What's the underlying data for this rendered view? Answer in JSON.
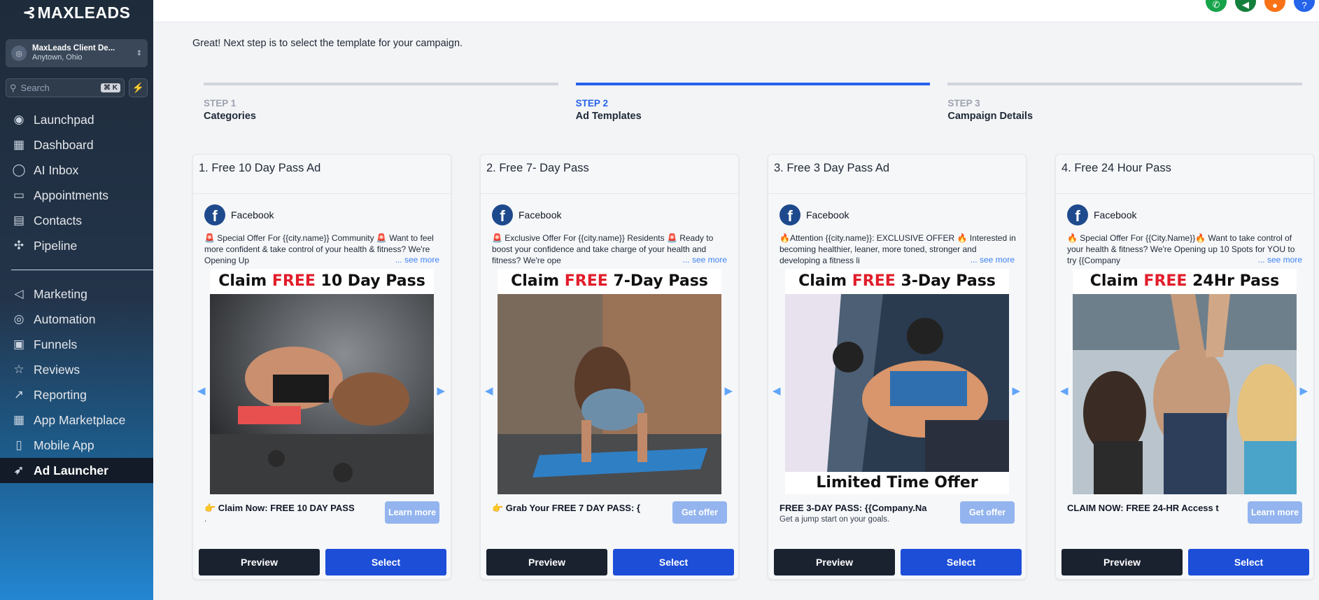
{
  "sidebar": {
    "logo": "MAXLEADS",
    "location": {
      "name": "MaxLeads Client De...",
      "city": "Anytown, Ohio"
    },
    "search": {
      "placeholder": "Search",
      "shortcut": "⌘ K"
    },
    "items": [
      {
        "label": "Launchpad",
        "icon": "rocket-circle-icon",
        "glyph": "◉"
      },
      {
        "label": "Dashboard",
        "icon": "grid-icon",
        "glyph": "▦"
      },
      {
        "label": "AI Inbox",
        "icon": "chat-icon",
        "glyph": "◯"
      },
      {
        "label": "Appointments",
        "icon": "calendar-icon",
        "glyph": "▭"
      },
      {
        "label": "Contacts",
        "icon": "contacts-icon",
        "glyph": "▤"
      },
      {
        "label": "Pipeline",
        "icon": "pipeline-icon",
        "glyph": "✣"
      }
    ],
    "items2": [
      {
        "label": "Marketing",
        "icon": "megaphone-icon",
        "glyph": "◁"
      },
      {
        "label": "Automation",
        "icon": "automation-icon",
        "glyph": "◎"
      },
      {
        "label": "Funnels",
        "icon": "funnel-icon",
        "glyph": "▣"
      },
      {
        "label": "Reviews",
        "icon": "star-icon",
        "glyph": "☆"
      },
      {
        "label": "Reporting",
        "icon": "trend-icon",
        "glyph": "↗"
      },
      {
        "label": "App Marketplace",
        "icon": "apps-icon",
        "glyph": "▦"
      },
      {
        "label": "Mobile App",
        "icon": "mobile-icon",
        "glyph": "▯"
      },
      {
        "label": "Ad Launcher",
        "icon": "rocket-icon",
        "glyph": "🚀"
      }
    ]
  },
  "topbar": {
    "icons": [
      {
        "name": "phone-icon",
        "glyph": "✆",
        "color": "#16a34a"
      },
      {
        "name": "megaphone-icon",
        "glyph": "◀",
        "color": "#15803d"
      },
      {
        "name": "bell-icon",
        "glyph": "●",
        "color": "#f97316"
      },
      {
        "name": "help-icon",
        "glyph": "?",
        "color": "#2563eb"
      }
    ]
  },
  "intro": "Great! Next step is to select the template for your campaign.",
  "steps": [
    {
      "num": "STEP 1",
      "label": "Categories"
    },
    {
      "num": "STEP 2",
      "label": "Ad Templates"
    },
    {
      "num": "STEP 3",
      "label": "Campaign Details"
    }
  ],
  "cards": [
    {
      "title": "1. Free 10 Day Pass Ad",
      "network": "Facebook",
      "desc": "🚨 Special Offer For {{city.name}} Community 🚨 Want to feel more confident & take control of your health & fitness? We're Opening Up",
      "see_more": "... see more",
      "headline_pre": "Claim ",
      "headline_free": "FREE",
      "headline_post": " 10 Day Pass",
      "cta_title": "👉 Claim Now: FREE 10 DAY PASS",
      "cta_sub": ".",
      "cta_btn": "Learn more"
    },
    {
      "title": "2. Free 7- Day Pass",
      "network": "Facebook",
      "desc": "🚨 Exclusive Offer For {{city.name}} Residents 🚨 Ready to boost your confidence and take charge of your health and fitness? We're ope",
      "see_more": "... see more",
      "headline_pre": "Claim ",
      "headline_free": "FREE",
      "headline_post": " 7-Day Pass",
      "cta_title": "👉 Grab Your FREE 7 DAY PASS: {",
      "cta_sub": "",
      "cta_btn": "Get offer"
    },
    {
      "title": "3. Free 3 Day Pass Ad",
      "network": "Facebook",
      "desc": "🔥Attention {{city.name}}: EXCLUSIVE OFFER 🔥 Interested in becoming healthier, leaner, more toned, stronger and developing a fitness li",
      "see_more": "... see more",
      "headline_pre": "Claim ",
      "headline_free": "FREE",
      "headline_post": " 3-Day Pass",
      "sub_banner": "Limited Time Offer",
      "cta_title": "FREE 3-DAY PASS: {{Company.Na",
      "cta_sub": "Get a jump start on your goals.",
      "cta_btn": "Get offer"
    },
    {
      "title": "4. Free 24 Hour Pass",
      "network": "Facebook",
      "desc": "🔥 Special Offer For {{City.Name}}🔥 Want to take control of your health & fitness? We're Opening up 10 Spots for YOU to try {{Company",
      "see_more": "... see more",
      "headline_pre": "Claim ",
      "headline_free": "FREE",
      "headline_post": " 24Hr Pass",
      "cta_title": "CLAIM NOW: FREE 24-HR Access t",
      "cta_sub": "",
      "cta_btn": "Learn more"
    }
  ],
  "buttons": {
    "preview": "Preview",
    "select": "Select"
  }
}
